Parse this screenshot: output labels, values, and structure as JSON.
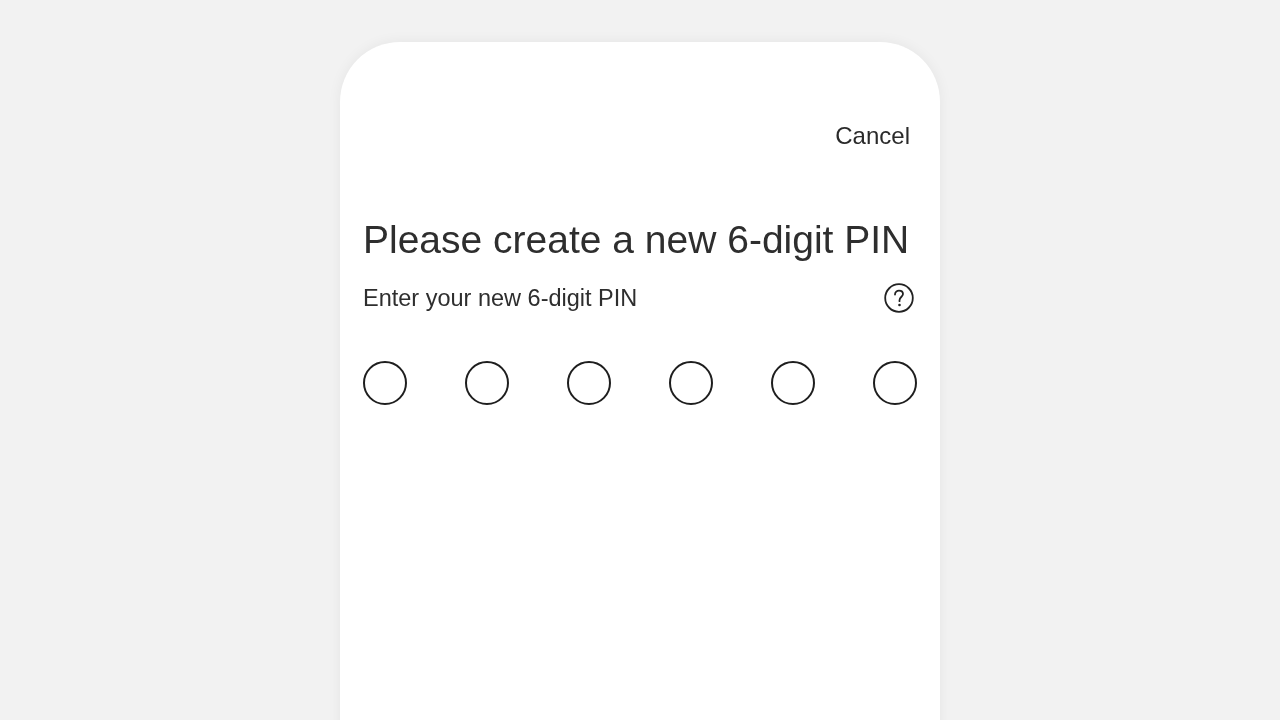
{
  "top_bar": {
    "cancel": "Cancel"
  },
  "title": "Please create a new 6-digit PIN",
  "prompt": "Enter your new 6-digit PIN",
  "pin_slots": [
    {
      "filled": false
    },
    {
      "filled": false
    },
    {
      "filled": false
    },
    {
      "filled": false
    },
    {
      "filled": false
    },
    {
      "filled": false
    }
  ]
}
